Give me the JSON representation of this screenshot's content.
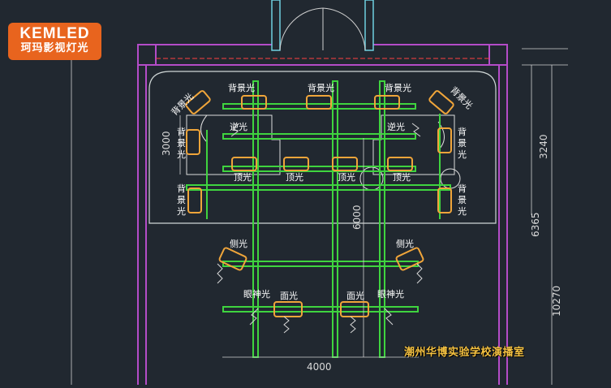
{
  "logo": {
    "brand": "KEMLED",
    "subtitle": "珂玛影视灯光"
  },
  "caption": "潮州华博实验学校演播室",
  "labels": {
    "backlight": "背景光",
    "backlight_v1": "背",
    "backlight_v2": "景",
    "backlight_v3": "光",
    "reverse": "逆光",
    "top": "顶光",
    "side": "侧光",
    "eye": "眼神光",
    "face": "面光"
  },
  "dims": {
    "d3000": "3000",
    "d3240": "3240",
    "d6000": "6000",
    "d6365": "6365",
    "d10270": "10270",
    "d4000": "4000"
  },
  "colors": {
    "background": "#212830",
    "wall": "#b44cc8",
    "truss": "#3fd43f",
    "fixture": "#f0a53a",
    "accent": "#e8641e"
  }
}
